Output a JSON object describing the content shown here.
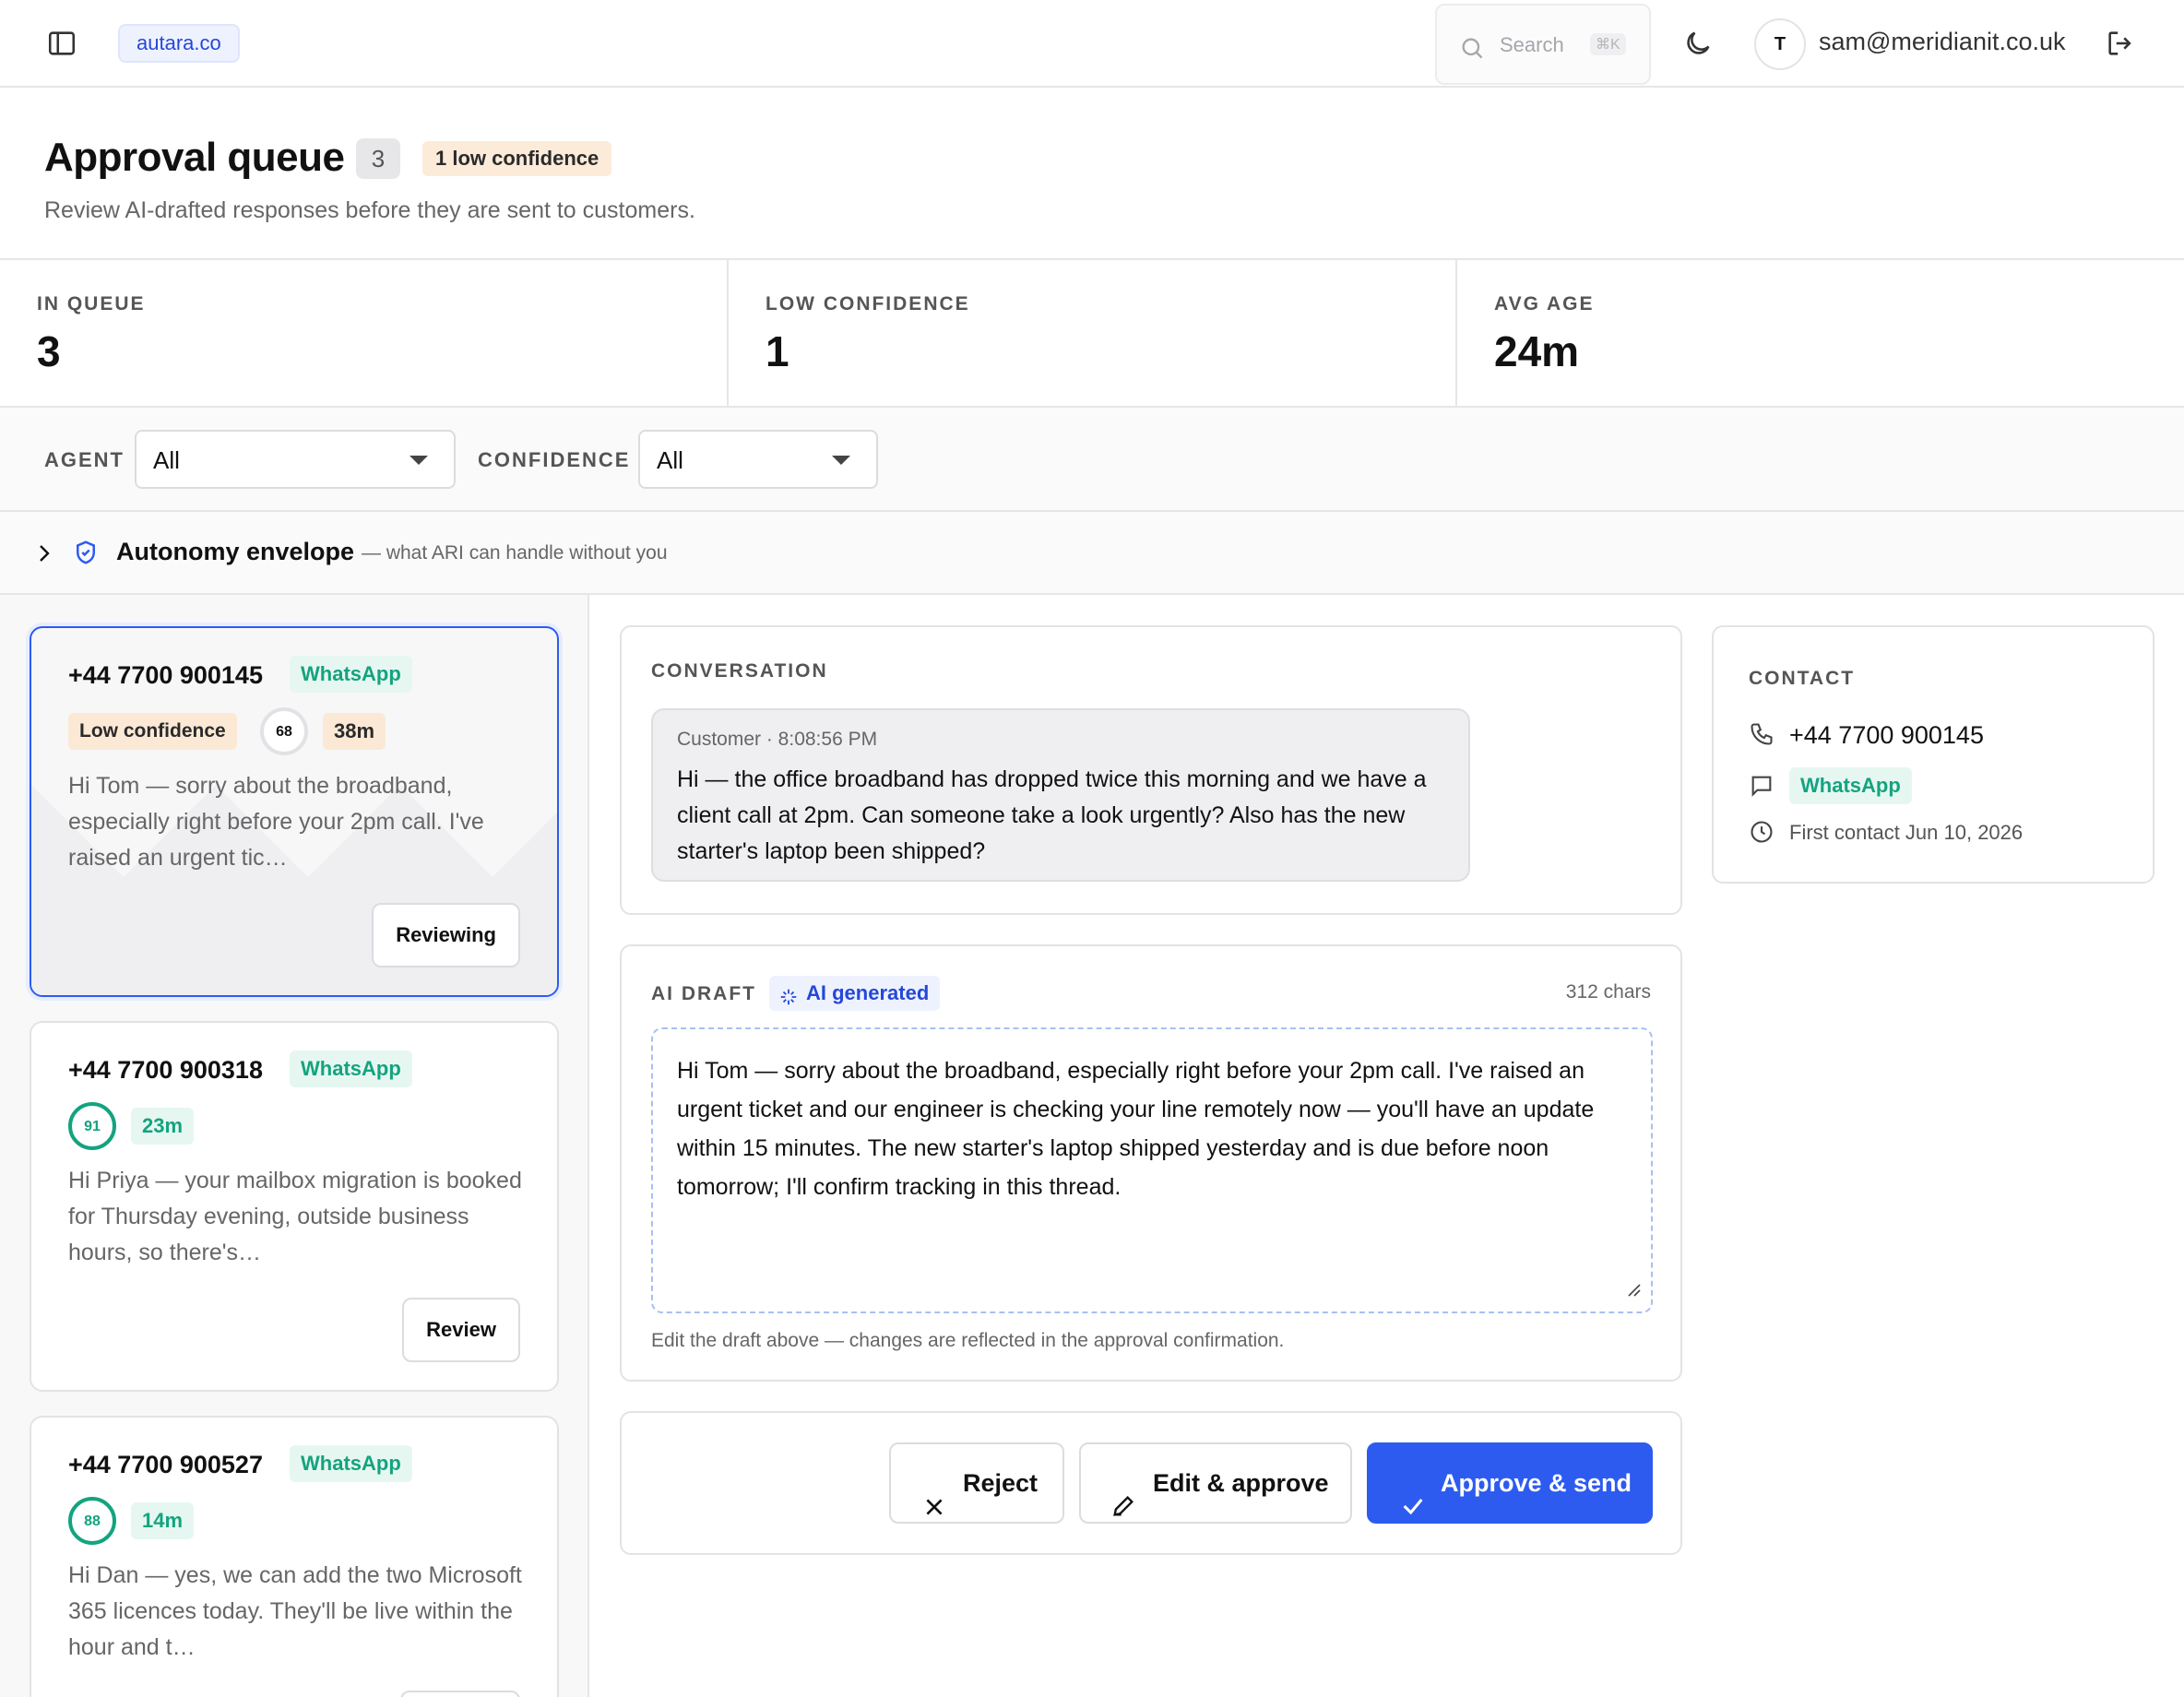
{
  "topbar": {
    "workspace": "autara.co",
    "search_placeholder": "Search",
    "search_shortcut": "⌘K",
    "avatar_initial": "T",
    "user_email": "sam@meridianit.co.uk"
  },
  "header": {
    "title": "Approval queue",
    "count": "3",
    "low_confidence_badge": "1 low confidence",
    "subtitle": "Review AI-drafted responses before they are sent to customers."
  },
  "stats": [
    {
      "label": "IN QUEUE",
      "value": "3"
    },
    {
      "label": "LOW CONFIDENCE",
      "value": "1"
    },
    {
      "label": "AVG AGE",
      "value": "24m"
    }
  ],
  "filters": {
    "agent_label": "AGENT",
    "agent_value": "All",
    "confidence_label": "CONFIDENCE",
    "confidence_value": "All"
  },
  "autonomy": {
    "title": "Autonomy envelope",
    "subtitle": "— what ARI can handle without you"
  },
  "queue": [
    {
      "phone": "+44 7700 900145",
      "channel": "WhatsApp",
      "low_confidence_label": "Low confidence",
      "score": "68",
      "score_fraction": 0.68,
      "age": "38m",
      "excerpt": "Hi Tom — sorry about the broadband, especially right before your 2pm call. I've raised an urgent tic…",
      "action": "Reviewing"
    },
    {
      "phone": "+44 7700 900318",
      "channel": "WhatsApp",
      "score": "91",
      "score_fraction": 0.91,
      "age": "23m",
      "excerpt": "Hi Priya — your mailbox migration is booked for Thursday evening, outside business hours, so there's…",
      "action": "Review"
    },
    {
      "phone": "+44 7700 900527",
      "channel": "WhatsApp",
      "score": "88",
      "score_fraction": 0.88,
      "age": "14m",
      "excerpt": "Hi Dan — yes, we can add the two Microsoft 365 licences today. They'll be live within the hour and t…"
    }
  ],
  "conversation": {
    "label": "CONVERSATION",
    "meta": "Customer · 8:08:56 PM",
    "message": "Hi — the office broadband has dropped twice this morning and we have a client call at 2pm. Can someone take a look urgently? Also has the new starter's laptop been shipped?"
  },
  "draft": {
    "label": "AI DRAFT",
    "ai_chip": "AI generated",
    "chars": "312 chars",
    "text": "Hi Tom — sorry about the broadband, especially right before your 2pm call. I've raised an urgent ticket and our engineer is checking your line remotely now — you'll have an update within 15 minutes. The new starter's laptop shipped yesterday and is due before noon tomorrow; I'll confirm tracking in this thread.",
    "hint": "Edit the draft above — changes are reflected in the approval confirmation."
  },
  "actions": {
    "reject": "Reject",
    "edit_approve": "Edit & approve",
    "approve_send": "Approve & send"
  },
  "contact": {
    "label": "CONTACT",
    "phone": "+44 7700 900145",
    "channel": "WhatsApp",
    "first_contact": "First contact Jun 10, 2026"
  },
  "colors": {
    "accent": "#2d5bf0",
    "whatsapp": "#14a37f",
    "warning_bg": "#fbe9d6"
  }
}
